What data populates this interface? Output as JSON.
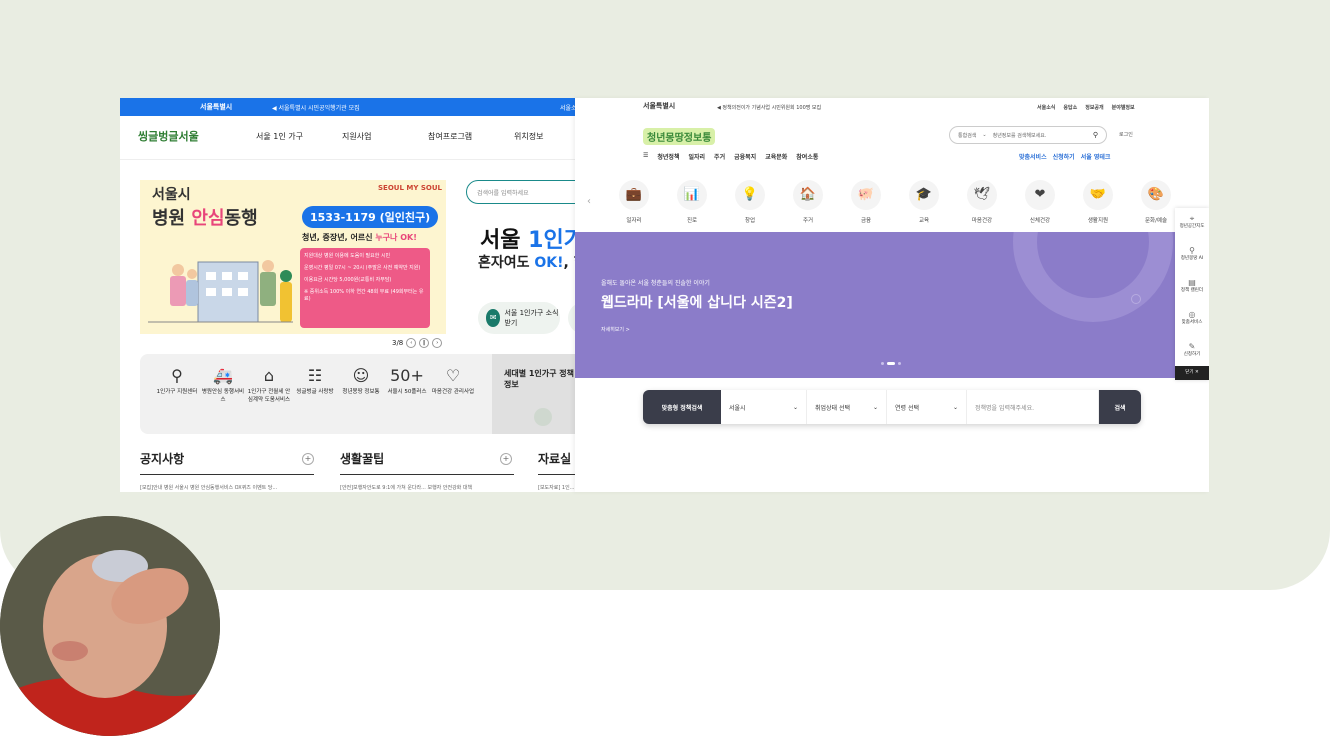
{
  "left": {
    "topbar": {
      "logo": "서울특별시",
      "notice": "◀ 서울특별시 시민공익행기관 모집",
      "right": "서울소"
    },
    "brand": "씽글벙글서울",
    "menu": [
      "서울 1인 가구",
      "지원사업",
      "참여프로그램",
      "위치정보"
    ],
    "hero": {
      "line1": "서울시",
      "line2a": "병원 ",
      "line2b": "안심",
      "line2c": "동행",
      "brand": "SEOUL MY SOUL",
      "phone": "1533-1179 (일인친구)",
      "sub_a": "청년, 중장년, 어르신 ",
      "sub_b": "누구나 OK!",
      "box": [
        "지원대상 병원 이용에 도움이 필요한 시민",
        "운영시간 평일 07시 ~ 20시 (주말은 사전 예약만 지원)",
        "이용요금 시간당 5,000원(교통비 자부담)",
        "※ 중위소득 100% 이하 연간 48회 무료 (49회부터는 유료)"
      ]
    },
    "pager": "3/8",
    "search_placeholder": "검색어를 입력하세요",
    "big_a": "서울 ",
    "big_b": "1인가",
    "big2_a": "혼자여도 ",
    "big2_b": "OK!",
    "big2_c": ", 함",
    "news_btn": "서울 1인가구 소식 받기",
    "services": [
      {
        "icon": "⚲",
        "label": "1인가구 지원센터"
      },
      {
        "icon": "🚑",
        "label": "병원안심 동행서비스"
      },
      {
        "icon": "⌂",
        "label": "1인가구 전월세 안심계약 도움서비스"
      },
      {
        "icon": "☷",
        "label": "씽글벙글 사랑방"
      },
      {
        "icon": "☺",
        "label": "청년몽땅 정보통"
      },
      {
        "icon": "50+",
        "label": "서울시 50플러스"
      },
      {
        "icon": "♡",
        "label": "마음건강 관리사업"
      }
    ],
    "side_title": "세대별 1인가구 정책정보",
    "boards": [
      {
        "title": "공지사항",
        "item": "[모집]안내 병원 서울시 병원 안심동행서비스 OX퀴즈 이벤트 당..."
      },
      {
        "title": "생활꿀팁",
        "item": "[안전]보행자안도로 9:1에 가쳐 운다라... 보행자 안전강화 대책"
      },
      {
        "title": "자료실",
        "item": "[보도자료] 1인..."
      }
    ]
  },
  "right": {
    "topbar": {
      "logo": "서울특별시",
      "notice": "◀ 정책의전이가 기념사업 시민위원회 100명 모집",
      "links": [
        "서울소식",
        "응답소",
        "정보공개",
        "분야별정보"
      ]
    },
    "brand": "청년몽땅정보통",
    "search": {
      "scope": "통합검색",
      "placeholder": "청년정보를 검색해보세요."
    },
    "login": "로그인",
    "menu": [
      "☰",
      "청년정책",
      "일자리",
      "주거",
      "금융복지",
      "교육문화",
      "참여소통"
    ],
    "actions": [
      "맞춤서비스",
      "신청하기",
      "서울 영테크"
    ],
    "categories": [
      {
        "icon": "💼",
        "label": "일자리"
      },
      {
        "icon": "📊",
        "label": "진로"
      },
      {
        "icon": "💡",
        "label": "창업"
      },
      {
        "icon": "🏠",
        "label": "주거"
      },
      {
        "icon": "🐖",
        "label": "금융"
      },
      {
        "icon": "🎓",
        "label": "교육"
      },
      {
        "icon": "🕊",
        "label": "마음건강"
      },
      {
        "icon": "❤",
        "label": "신체건강"
      },
      {
        "icon": "🤝",
        "label": "생활지원"
      },
      {
        "icon": "🎨",
        "label": "문화/예술"
      }
    ],
    "banner": {
      "kicker": "올해도 돌아온 서울 청춘들의 진솔한 이야기",
      "title": "웹드라마 [서울에 삽니다 시즌2]",
      "more": "자세히보기 >"
    },
    "policy": {
      "label": "맞춤형 정책검색",
      "region": "서울시",
      "job": "취업상태 선택",
      "age": "연령 선택",
      "placeholder": "정책명을 입력해주세요.",
      "button": "검색"
    },
    "side": [
      {
        "icon": "⌖",
        "label": "청년공간지도"
      },
      {
        "icon": "⚲",
        "label": "청년몽땅 AI"
      },
      {
        "icon": "▤",
        "label": "정책 캘린더"
      },
      {
        "icon": "◎",
        "label": "맞춤서비스"
      },
      {
        "icon": "✎",
        "label": "신청하기"
      }
    ],
    "close": "닫기 ✕"
  }
}
